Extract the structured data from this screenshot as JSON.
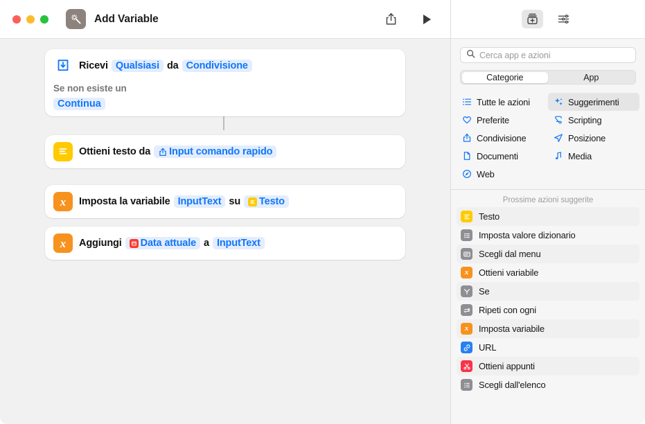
{
  "window": {
    "title": "Add Variable",
    "app_icon": "sparkle-wand-icon",
    "traffic_lights": [
      "close",
      "minimize",
      "zoom"
    ],
    "share_label": "Condividi",
    "run_label": "Esegui"
  },
  "workflow": {
    "actions": [
      {
        "id": "receive-input",
        "glyph": "receive-icon",
        "glyph_style": "bare-blue",
        "parts": [
          {
            "type": "text",
            "value": "Ricevi"
          },
          {
            "type": "token",
            "value": "Qualsiasi"
          },
          {
            "type": "text",
            "value": "da"
          },
          {
            "type": "token",
            "value": "Condivisione"
          }
        ],
        "condition_label": "Se non esiste un",
        "condition_token": "Continua"
      },
      {
        "id": "get-text-from",
        "glyph": "text-lines-icon",
        "glyph_style": "yellow",
        "parts": [
          {
            "type": "text",
            "value": "Ottieni testo da"
          },
          {
            "type": "token",
            "value": "Input comando rapido",
            "icon": "share-up-icon"
          }
        ]
      },
      {
        "id": "set-variable",
        "glyph": "variable-x-icon",
        "glyph_style": "orange",
        "parts": [
          {
            "type": "text",
            "value": "Imposta la variabile"
          },
          {
            "type": "token",
            "value": "InputText"
          },
          {
            "type": "text",
            "value": "su"
          },
          {
            "type": "token",
            "value": "Testo",
            "icon": "text-lines-mini-icon"
          }
        ]
      },
      {
        "id": "add-to-variable",
        "glyph": "variable-x-icon",
        "glyph_style": "orange",
        "parts": [
          {
            "type": "text",
            "value": "Aggiungi"
          },
          {
            "type": "token",
            "value": "Data attuale",
            "icon": "calendar-mini-icon"
          },
          {
            "type": "text",
            "value": "a"
          },
          {
            "type": "token",
            "value": "InputText"
          }
        ]
      }
    ]
  },
  "sidebar": {
    "toolbar": [
      {
        "name": "action-library-button",
        "icon": "library-add-icon",
        "selected": true
      },
      {
        "name": "shortcut-details-button",
        "icon": "sliders-icon",
        "selected": false
      }
    ],
    "search": {
      "placeholder": "Cerca app e azioni",
      "value": "",
      "icon": "search-icon"
    },
    "segmented": {
      "options": [
        "Categorie",
        "App"
      ],
      "selected": "Categorie"
    },
    "categories": [
      {
        "label": "Tutte le azioni",
        "icon": "list-bullet-icon",
        "highlighted": false
      },
      {
        "label": "Suggerimenti",
        "icon": "sparkles-icon",
        "highlighted": true
      },
      {
        "label": "Preferite",
        "icon": "heart-icon",
        "highlighted": false
      },
      {
        "label": "Scripting",
        "icon": "scroll-icon",
        "highlighted": false
      },
      {
        "label": "Condivisione",
        "icon": "share-up-icon",
        "highlighted": false
      },
      {
        "label": "Posizione",
        "icon": "paper-plane-icon",
        "highlighted": false
      },
      {
        "label": "Documenti",
        "icon": "document-icon",
        "highlighted": false
      },
      {
        "label": "Media",
        "icon": "music-note-icon",
        "highlighted": false
      },
      {
        "label": "Web",
        "icon": "compass-icon",
        "highlighted": false
      }
    ],
    "suggestions_header": "Prossime azioni suggerite",
    "suggestions": [
      {
        "label": "Testo",
        "glyph": "text-lines-icon",
        "color": "yellow",
        "alt": true
      },
      {
        "label": "Imposta valore dizionario",
        "glyph": "dictionary-icon",
        "color": "gray",
        "alt": false
      },
      {
        "label": "Scegli dal menu",
        "glyph": "menu-icon",
        "color": "gray",
        "alt": true
      },
      {
        "label": "Ottieni variabile",
        "glyph": "variable-x-icon",
        "color": "orange",
        "alt": false
      },
      {
        "label": "Se",
        "glyph": "branch-icon",
        "color": "gray",
        "alt": true
      },
      {
        "label": "Ripeti con ogni",
        "glyph": "repeat-icon",
        "color": "gray",
        "alt": false
      },
      {
        "label": "Imposta variabile",
        "glyph": "variable-x-icon",
        "color": "orange",
        "alt": true
      },
      {
        "label": "URL",
        "glyph": "link-icon",
        "color": "blue",
        "alt": false
      },
      {
        "label": "Ottieni appunti",
        "glyph": "scissors-icon",
        "color": "red",
        "alt": true
      },
      {
        "label": "Scegli dall'elenco",
        "glyph": "list-icon",
        "color": "gray",
        "alt": false
      }
    ]
  },
  "colors": {
    "accent_blue": "#1277f8",
    "token_bg": "#e3edfd",
    "yellow": "#ffcb00",
    "orange": "#f7921e",
    "canvas_bg": "#f1f1f1",
    "sidebar_bg": "#f6f6f6"
  }
}
